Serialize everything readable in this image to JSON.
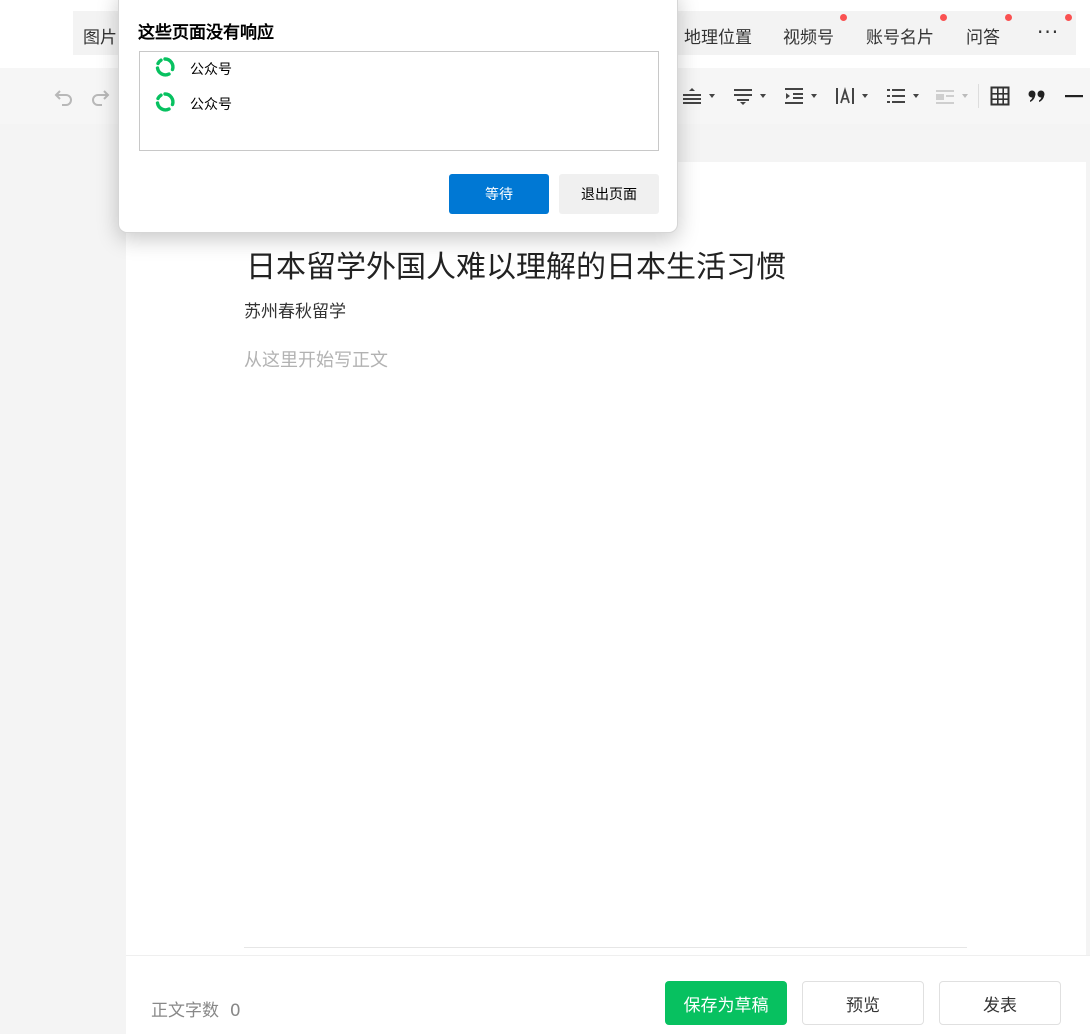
{
  "tabs": [
    "图片",
    "地理位置",
    "视频号",
    "账号名片",
    "问答"
  ],
  "more_glyph": "···",
  "toolbar_icons": [
    "undo-icon",
    "redo-icon",
    "align-icon",
    "paragraph-spacing-icon",
    "indent-icon",
    "letter-spacing-icon",
    "list-icon",
    "background-color-icon",
    "table-icon",
    "quote-icon",
    "horizontal-rule-icon"
  ],
  "article": {
    "title": "日本留学外国人难以理解的日本生活习惯",
    "author": "苏州春秋留学",
    "body_placeholder": "从这里开始写正文"
  },
  "footer": {
    "word_count_label": "正文字数",
    "word_count": "0",
    "save_draft": "保存为草稿",
    "preview": "预览",
    "publish": "发表"
  },
  "dialog": {
    "title": "这些页面没有响应",
    "pages": [
      "公众号",
      "公众号"
    ],
    "wait": "等待",
    "exit": "退出页面"
  },
  "colors": {
    "accent_green": "#07c160",
    "notification_dot": "#fa5151",
    "dialog_primary": "#0078d4"
  }
}
